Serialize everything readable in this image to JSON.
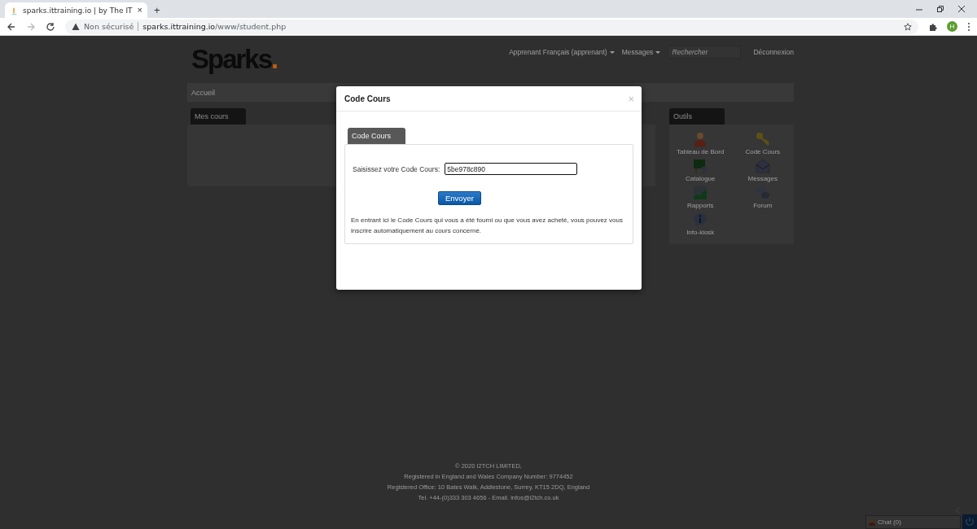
{
  "browser": {
    "tab_title": "sparks.ittraining.io | by The IT",
    "tab_close": "×",
    "new_tab": "+",
    "security": "Non sécurisé",
    "url_host": "sparks.ittraining.io",
    "url_path": "/www/student.php",
    "profile_initial": "H"
  },
  "header": {
    "logo": "Sparks",
    "logo_dot": ".",
    "menu": [
      {
        "label": "Apprenant Français (apprenant)",
        "dropdown": true
      },
      {
        "label": "Messages",
        "dropdown": true
      }
    ],
    "search": {
      "placeholder": "Rechercher"
    },
    "logout": "Déconnexion"
  },
  "breadcrumb": "Accueil",
  "courses_panel": {
    "title": "Mes cours"
  },
  "tools_panel": {
    "title": "Outils",
    "items": [
      {
        "label": "Tableau de Bord",
        "kind": "person"
      },
      {
        "label": "Code Cours",
        "kind": "key"
      },
      {
        "label": "Catalogue",
        "kind": "board"
      },
      {
        "label": "Messages",
        "kind": "envelope"
      },
      {
        "label": "Rapports",
        "kind": "chart"
      },
      {
        "label": "Forum",
        "kind": "bubbles"
      },
      {
        "label": "Info-kiosk",
        "kind": "info"
      }
    ]
  },
  "footer": [
    "© 2020 I2TCH LIMITED,",
    "Registered in England and Wales Company Number: 9774452",
    "Registered Office: 10 Bates Walk, Addlestone, Surrey, KT15 2DQ, England",
    "Tel. +44-(0)333 303 4656 - Email. infos@i2tch.co.uk"
  ],
  "chat": {
    "label": "Chat (0)"
  },
  "modal": {
    "title": "Code Cours",
    "close": "×",
    "tabs": [
      {
        "label": "Code Cours",
        "selected": true
      }
    ],
    "field_label": "Saisissez votre Code Cours:",
    "field_value": "5be978c890",
    "submit": "Envoyer",
    "help": "En entrant ici le Code Cours qui vous a été fourni ou que vous avez acheté, vous pouvez vous inscrire automatiquement au cours concerné."
  }
}
